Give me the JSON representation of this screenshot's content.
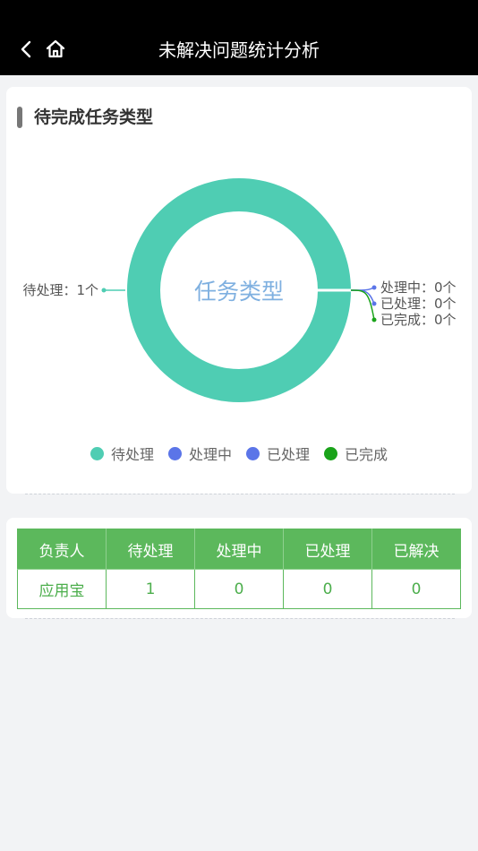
{
  "header": {
    "title": "未解决问题统计分析",
    "back_icon": "chevron-left-icon",
    "home_icon": "home-icon"
  },
  "section": {
    "title": "待完成任务类型"
  },
  "chart_data": {
    "type": "pie",
    "center_label": "任务类型",
    "categories": [
      "待处理",
      "处理中",
      "已处理",
      "已完成"
    ],
    "values": [
      1,
      0,
      0,
      0
    ],
    "colors": [
      "#4fcdb3",
      "#5b75e8",
      "#5b75e8",
      "#1aa31a"
    ],
    "slice_labels": [
      "待处理：1个",
      "处理中：0个",
      "已处理：0个",
      "已完成：0个"
    ],
    "legend_position": "bottom"
  },
  "table": {
    "headers": [
      "负责人",
      "待处理",
      "处理中",
      "已处理",
      "已解决"
    ],
    "rows": [
      [
        "应用宝",
        "1",
        "0",
        "0",
        "0"
      ]
    ]
  }
}
